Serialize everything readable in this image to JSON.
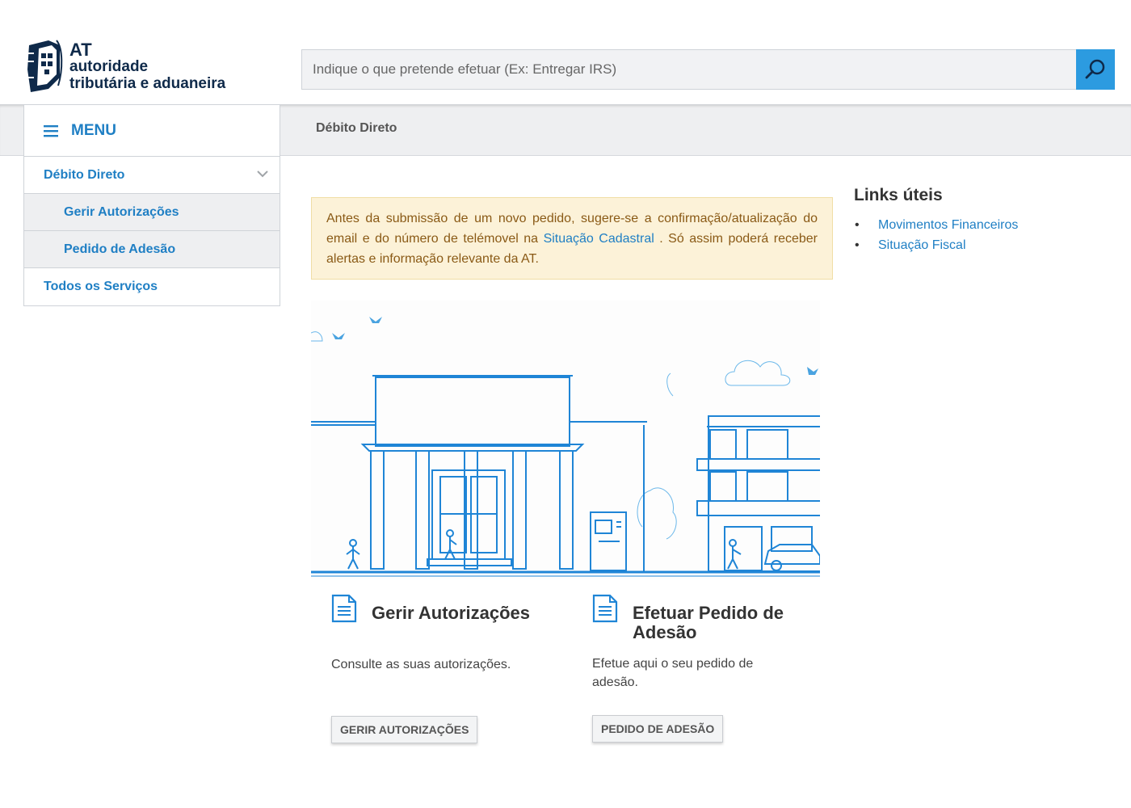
{
  "header": {
    "logo": {
      "abbr": "AT",
      "line1": "autoridade",
      "line2": "tributária e aduaneira"
    },
    "search": {
      "placeholder": "Indique o que pretende efetuar (Ex: Entregar IRS)",
      "button_icon": "search-icon"
    }
  },
  "breadcrumb": "Débito Direto",
  "menu": {
    "label": "MENU",
    "icon": "hamburger-icon",
    "items": [
      {
        "label": "Débito Direto",
        "level": 1,
        "expanded": true
      },
      {
        "label": "Gerir Autorizações",
        "level": 2
      },
      {
        "label": "Pedido de Adesão",
        "level": 2
      },
      {
        "label": "Todos os Serviços",
        "level": 1
      }
    ]
  },
  "alert": {
    "text_before": "Antes da submissão de um novo pedido, sugere-se a confirmação/atualização do email e do número de telémovel na",
    "link": "Situação Cadastral",
    "text_after": ". Só assim poderá receber alertas e informação relevante da AT."
  },
  "cards": [
    {
      "title": "Gerir Autorizações",
      "description": "Consulte as suas autorizações.",
      "button": "GERIR AUTORIZAÇÕES",
      "icon": "document-icon"
    },
    {
      "title": "Efetuar Pedido de Adesão",
      "description": "Efetue aqui o seu pedido de adesão.",
      "button": "PEDIDO DE ADESÃO",
      "icon": "document-icon"
    }
  ],
  "links": {
    "title": "Links úteis",
    "items": [
      "Movimentos Financeiros",
      "Situação Fiscal"
    ]
  },
  "colors": {
    "brand_blue": "#1f7fc4",
    "search_button": "#2c9be0",
    "alert_bg": "#fcf2d8",
    "alert_text": "#8a5a16",
    "logo_navy": "#0f2a4a"
  }
}
